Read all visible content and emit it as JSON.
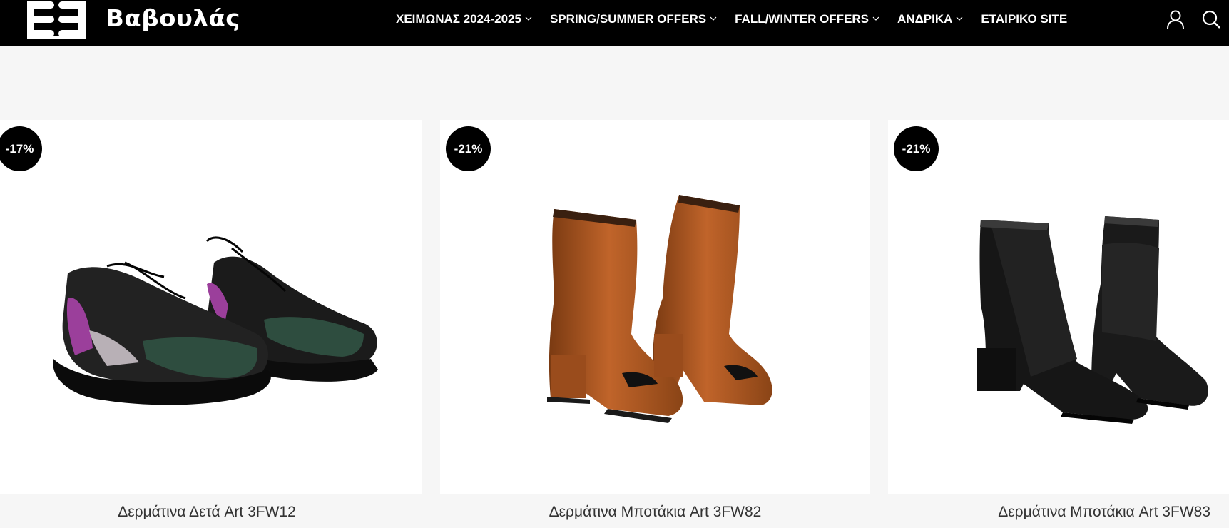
{
  "brand": {
    "name": "Βαβουλάς"
  },
  "nav": {
    "items": [
      {
        "label": "ΧΕΙΜΩΝΑΣ 2024-2025",
        "has_dropdown": true
      },
      {
        "label": "SPRING/SUMMER OFFERS",
        "has_dropdown": true
      },
      {
        "label": "FALL/WINTER OFFERS",
        "has_dropdown": true
      },
      {
        "label": "ΑΝΔΡΙΚΑ",
        "has_dropdown": true
      },
      {
        "label": "ΕΤΑΙΡΙΚΟ SITE",
        "has_dropdown": false
      }
    ]
  },
  "header_icons": [
    "user-icon",
    "search-icon"
  ],
  "products": [
    {
      "discount": "-17%",
      "title": "Δερμάτινα Δετά Art 3FW12",
      "image": "sneakers-black-purple-green"
    },
    {
      "discount": "-21%",
      "title": "Δερμάτινα Μποτάκια Art 3FW82",
      "image": "ankle-boots-copper"
    },
    {
      "discount": "-21%",
      "title": "Δερμάτινα Μποτάκια Art 3FW83",
      "image": "ankle-boots-black"
    }
  ],
  "colors": {
    "header_bg": "#000000",
    "page_bg": "#f6f6f6",
    "badge_bg": "#000000",
    "text": "#333333"
  }
}
